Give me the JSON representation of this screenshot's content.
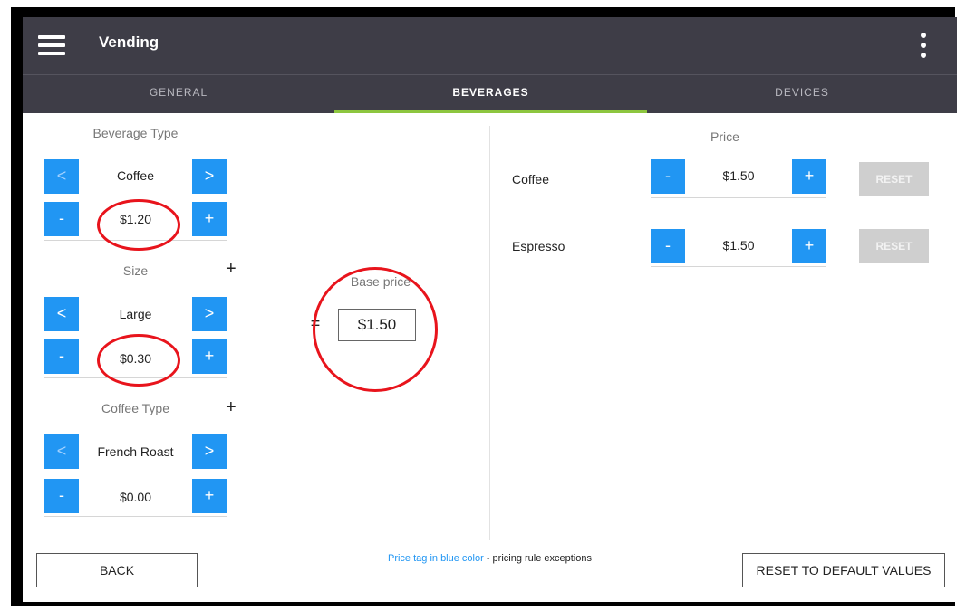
{
  "app": {
    "title": "Vending"
  },
  "tabs": [
    {
      "label": "GENERAL"
    },
    {
      "label": "BEVERAGES"
    },
    {
      "label": "DEVICES"
    }
  ],
  "left": {
    "beverage_type": {
      "label": "Beverage Type",
      "value": "Coffee",
      "price": "$1.20"
    },
    "size": {
      "label": "Size",
      "value": "Large",
      "price": "$0.30",
      "op": "+"
    },
    "coffee_type": {
      "label": "Coffee Type",
      "value": "French Roast",
      "price": "$0.00",
      "op": "+"
    },
    "prev": "<",
    "next": ">",
    "minus": "-",
    "plus": "+"
  },
  "base": {
    "label": "Base price",
    "equals": "=",
    "value": "$1.50"
  },
  "price_table": {
    "header": "Price",
    "rows": [
      {
        "name": "Coffee",
        "price": "$1.50",
        "reset": "RESET"
      },
      {
        "name": "Espresso",
        "price": "$1.50",
        "reset": "RESET"
      }
    ]
  },
  "footer": {
    "back": "BACK",
    "note_blue": "Price tag in blue color",
    "note_rest": " - pricing rule exceptions",
    "reset_all": "RESET TO DEFAULT VALUES"
  },
  "colors": {
    "accent": "#2196f3",
    "topbar": "#3e3d47",
    "tab_indicator": "#8dc63f",
    "annotation": "#e8141c"
  },
  "icons": {
    "menu": "hamburger-menu-icon",
    "more": "more-vertical-icon"
  }
}
